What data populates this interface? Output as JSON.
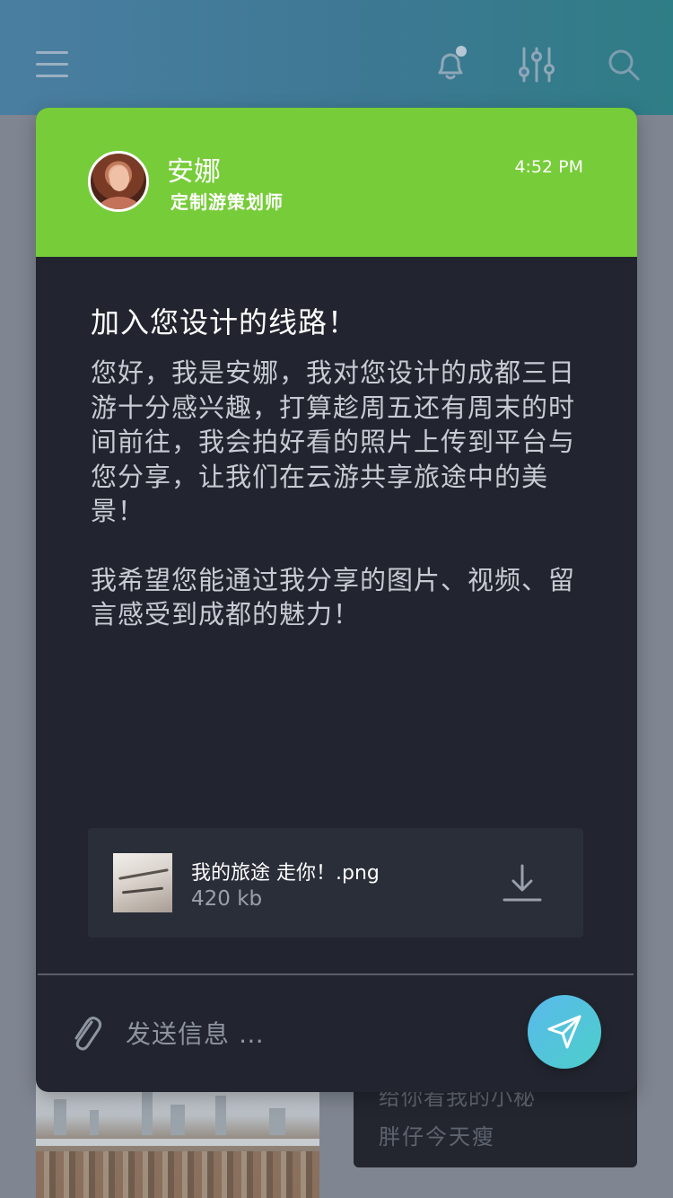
{
  "topbar": {
    "icons": [
      "menu-icon",
      "bell-icon",
      "filter-icon",
      "search-icon"
    ],
    "notification_dot": true
  },
  "background": {
    "card_line1": "给你看我的小秘",
    "card_line2": "胖仔今天瘦"
  },
  "message": {
    "sender_name": "安娜",
    "sender_role": "定制游策划师",
    "time": "4:52 PM",
    "title": "加入您设计的线路！",
    "paragraph1": "您好，我是安娜，我对您设计的成都三日游十分感兴趣，打算趁周五还有周末的时间前往，我会拍好看的照片上传到平台与您分享，让我们在云游共享旅途中的美景！",
    "paragraph2": "我希望您能通过我分享的图片、视频、留言感受到成都的魅力！"
  },
  "attachment": {
    "file_name": "我的旅途 走你！.png",
    "file_size": "420 kb",
    "icon": "download-icon"
  },
  "composer": {
    "placeholder": "发送信息 …",
    "value": ""
  },
  "colors": {
    "header_green": "#77cc39",
    "modal_bg": "#22252f",
    "send_gradient_start": "#5ab9ec",
    "send_gradient_end": "#4ccfca"
  }
}
